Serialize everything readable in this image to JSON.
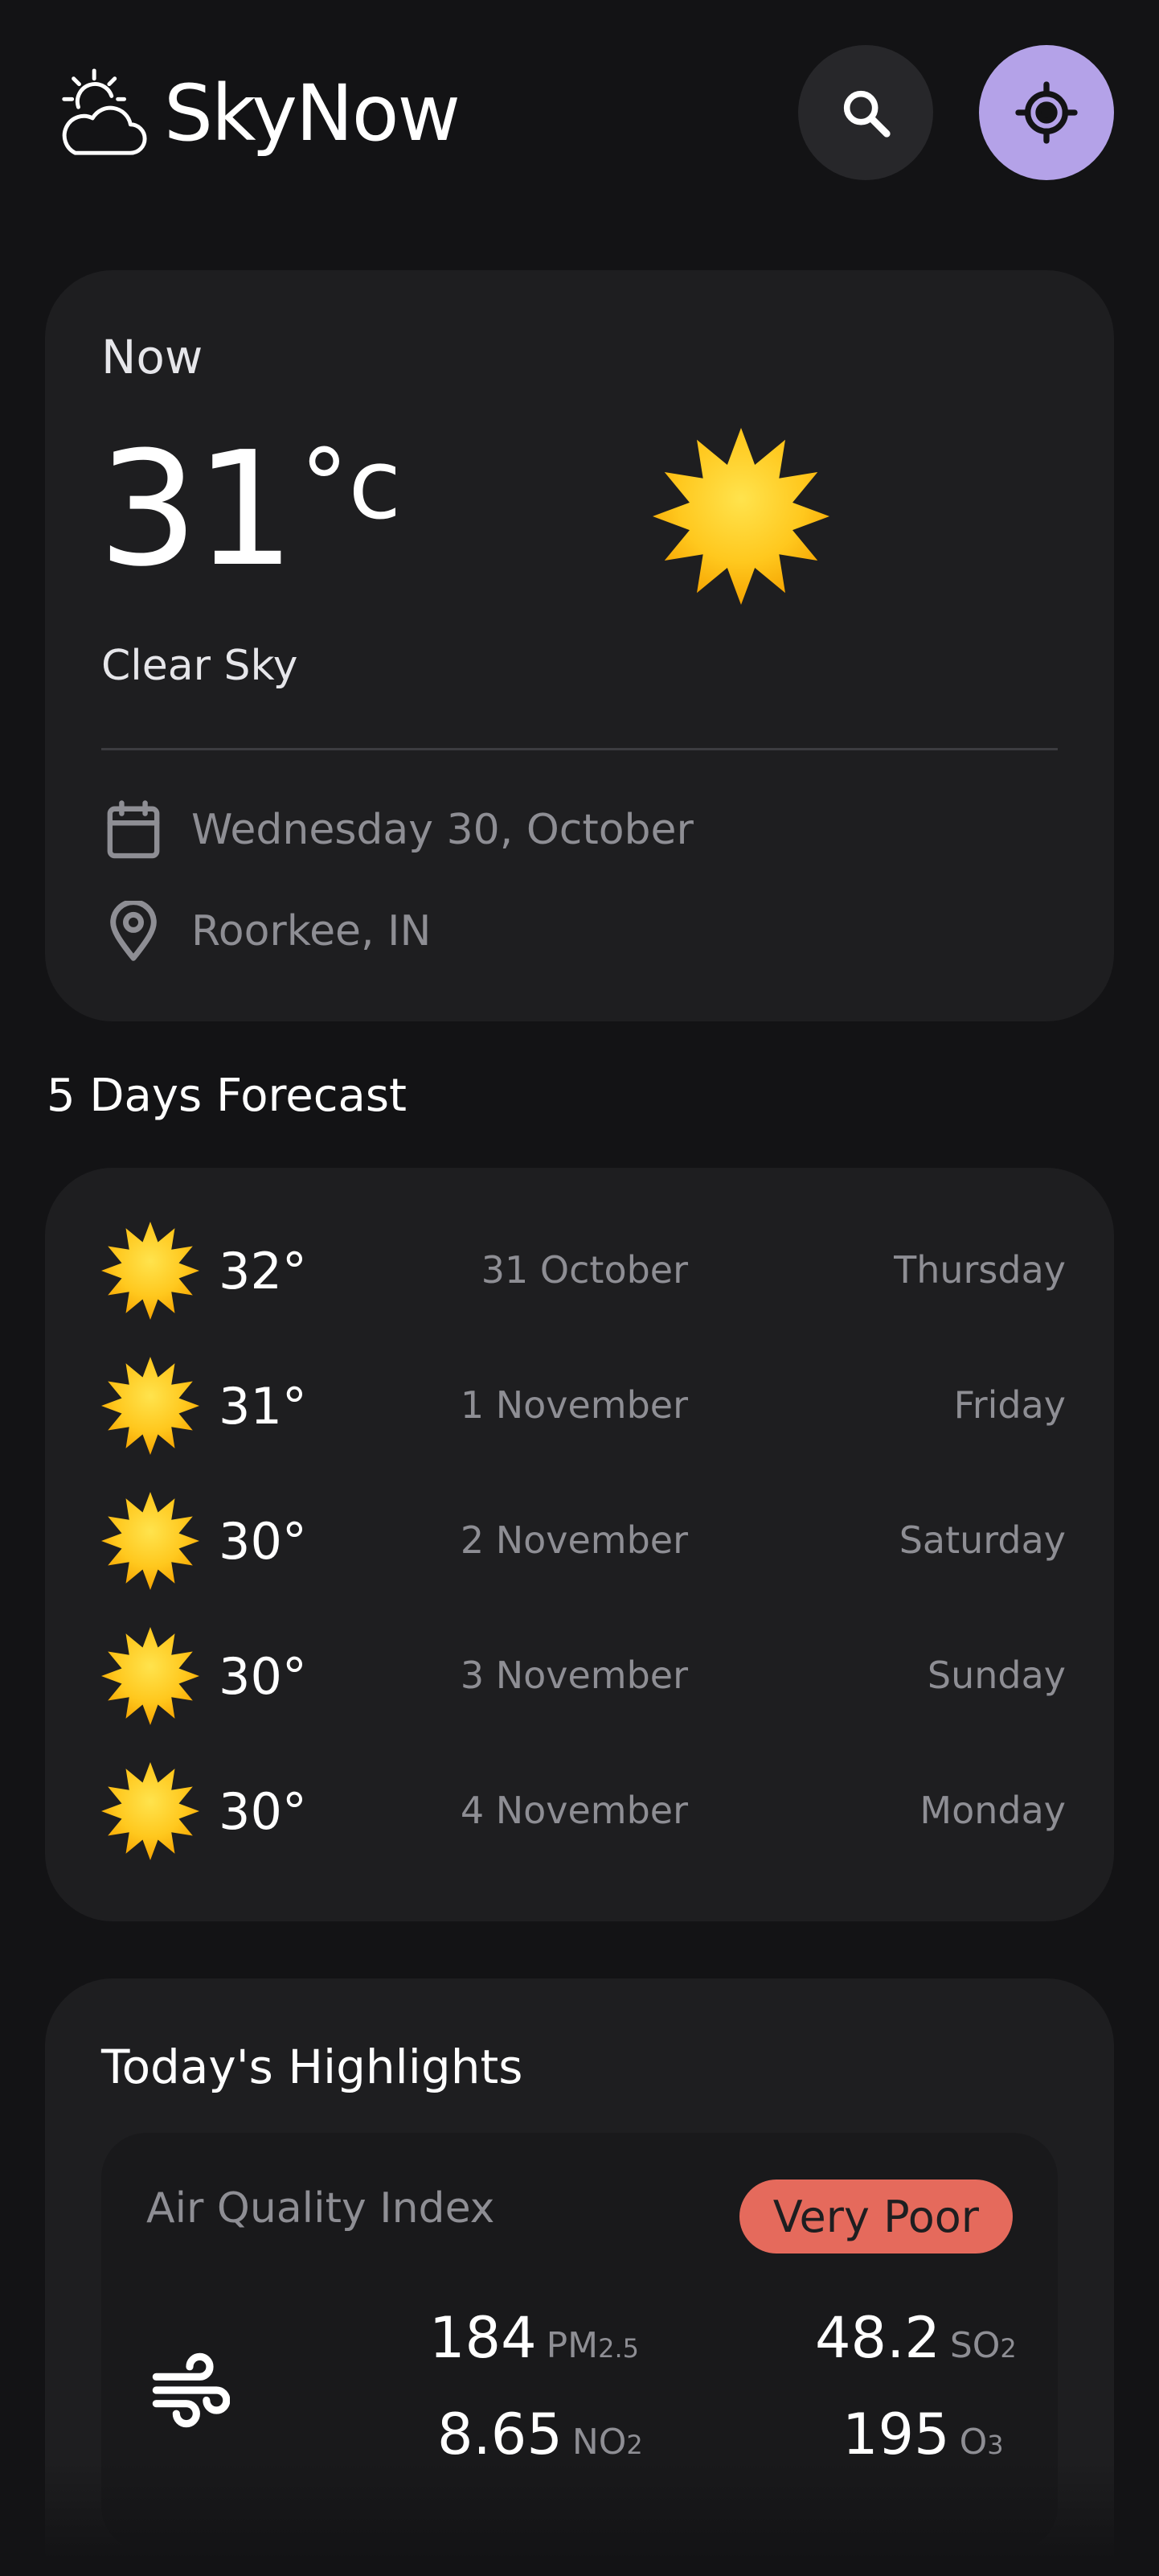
{
  "header": {
    "app_name": "SkyNow",
    "icons": {
      "logo": "cloud-sun-icon",
      "search": "search-icon",
      "locate": "crosshair-icon"
    },
    "colors": {
      "locate_button_bg": "#b4a2e8"
    }
  },
  "now": {
    "label": "Now",
    "temperature": "31",
    "unit": "°c",
    "condition": "Clear Sky",
    "date": "Wednesday 30, October",
    "location": "Roorkee, IN",
    "icons": {
      "weather": "sun-icon",
      "date": "calendar-icon",
      "location": "location-pin-icon"
    }
  },
  "forecast": {
    "title": "5 Days Forecast",
    "days": [
      {
        "temp": "32°",
        "date": "31 October",
        "day": "Thursday",
        "icon": "sun-icon"
      },
      {
        "temp": "31°",
        "date": "1 November",
        "day": "Friday",
        "icon": "sun-icon"
      },
      {
        "temp": "30°",
        "date": "2 November",
        "day": "Saturday",
        "icon": "sun-icon"
      },
      {
        "temp": "30°",
        "date": "3 November",
        "day": "Sunday",
        "icon": "sun-icon"
      },
      {
        "temp": "30°",
        "date": "4 November",
        "day": "Monday",
        "icon": "sun-icon"
      }
    ]
  },
  "highlights": {
    "title": "Today's Highlights",
    "aqi": {
      "title": "Air Quality Index",
      "status": "Very Poor",
      "status_color": "#e56a5c",
      "icon": "wind-icon",
      "pm25": {
        "value": "184",
        "label": "PM",
        "sub": "2.5"
      },
      "so2": {
        "value": "48.2",
        "label": "SO",
        "sub": "2"
      },
      "no2": {
        "value": "8.65",
        "label": "NO",
        "sub": "2"
      },
      "o3": {
        "value": "195",
        "label": "O",
        "sub": "3"
      }
    }
  }
}
